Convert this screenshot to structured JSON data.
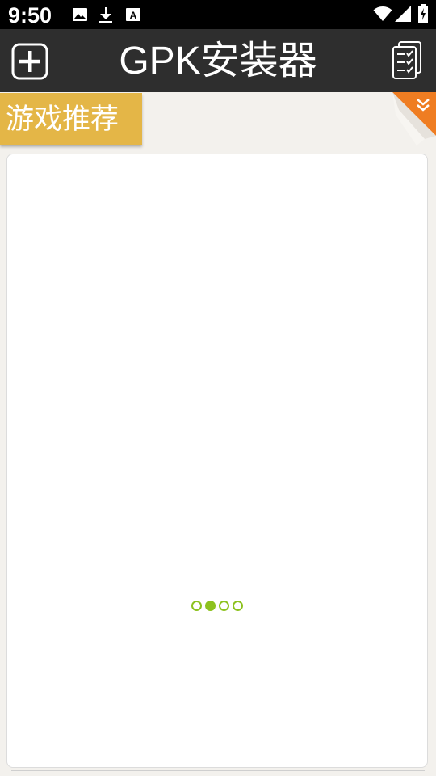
{
  "status_bar": {
    "time": "9:50",
    "left_icons": [
      "image-icon",
      "download-icon",
      "text-a-icon"
    ],
    "right_icons": [
      "wifi-icon",
      "signal-icon",
      "battery-icon"
    ]
  },
  "app_bar": {
    "title": "GPK安装器",
    "left_button_icon": "add-icon",
    "right_button_icon": "checklist-icon",
    "background_color": "#2e2e2e"
  },
  "section": {
    "tab_label": "游戏推荐",
    "tab_color": "#e4b647",
    "corner_icon": "double-chevron-down-icon",
    "corner_color": "#ef7d22"
  },
  "content": {
    "loading_indicator": {
      "dot_count": 4,
      "active_index": 1,
      "color": "#8dc21f"
    }
  }
}
